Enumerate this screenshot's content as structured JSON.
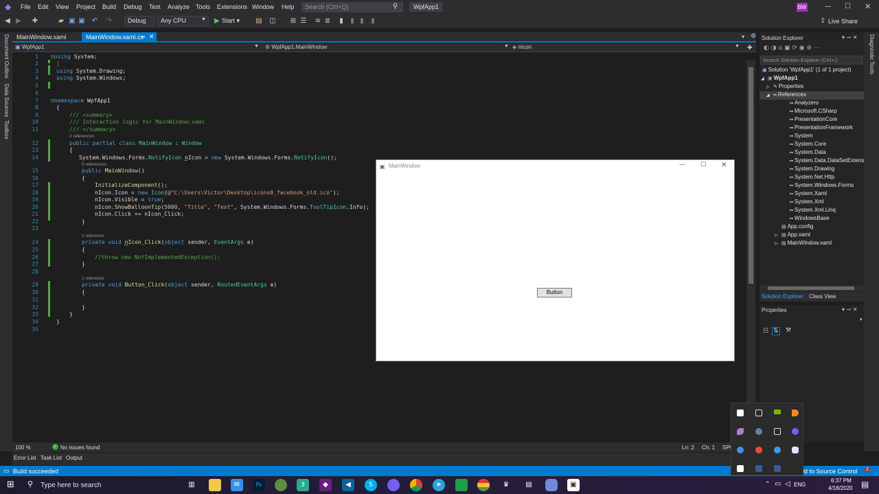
{
  "menu": [
    "File",
    "Edit",
    "View",
    "Project",
    "Build",
    "Debug",
    "Test",
    "Analyze",
    "Tools",
    "Extensions",
    "Window",
    "Help"
  ],
  "search_placeholder": "Search (Ctrl+Q)",
  "app_name": "WpfApp1",
  "user_initials": "BW",
  "live_share": "Live Share",
  "toolbar": {
    "config": "Debug",
    "platform": "Any CPU",
    "start": "Start"
  },
  "left_tool_tabs": [
    "Document Outline",
    "Data Sources",
    "Toolbox"
  ],
  "right_tool_tab": "Diagnostic Tools",
  "tabs": [
    {
      "label": "MainWindow.xaml"
    },
    {
      "label": "MainWindow.xaml.cs"
    }
  ],
  "nav": {
    "project": "WpfApp1",
    "class": "WpfApp1.MainWindow",
    "member": "nIcon"
  },
  "code": {
    "line_numbers": [
      "1",
      "2",
      "3",
      "4",
      "5",
      "6",
      "7",
      "8",
      "9",
      "10",
      "11",
      "12",
      "13",
      "14",
      "15",
      "16",
      "17",
      "18",
      "19",
      "20",
      "21",
      "22",
      "23",
      "24",
      "25",
      "26",
      "27",
      "28",
      "29",
      "30",
      "31",
      "32",
      "33",
      "34",
      "35"
    ],
    "references": {
      "r12": "2 references",
      "r15": "0 references",
      "r24": "1 reference",
      "r29": "1 reference"
    }
  },
  "editor_status": {
    "zoom": "100 %",
    "issues": "No issues found",
    "ln": "Ln: 2",
    "ch": "Ch: 1",
    "mode": "SPC"
  },
  "bottom_tabs": [
    "Error List",
    "Task List",
    "Output"
  ],
  "status": {
    "message": "Build succeeded",
    "source_control": "Add to Source Control",
    "badge": "2"
  },
  "solution_explorer": {
    "title": "Solution Explorer",
    "search": "Search Solution Explorer (Ctrl+;)",
    "solution": "Solution 'WpfApp1' (1 of 1 project)",
    "project": "WpfApp1",
    "properties": "Properties",
    "references": "References",
    "ref_items": [
      "Analyzers",
      "Microsoft.CSharp",
      "PresentationCore",
      "PresentationFramework",
      "System",
      "System.Core",
      "System.Data",
      "System.Data.DataSetExtens",
      "System.Drawing",
      "System.Net.Http",
      "System.Windows.Forms",
      "System.Xaml",
      "System.Xml",
      "System.Xml.Linq",
      "WindowsBase"
    ],
    "files": [
      "App.config",
      "App.xaml",
      "MainWindow.xaml"
    ],
    "bottom_tabs": [
      "Solution Explorer",
      "Class View"
    ]
  },
  "properties_title": "Properties",
  "main_window": {
    "title": "MainWindow",
    "button": "Button"
  },
  "taskbar": {
    "search": "Type here to search",
    "lang": "ENG",
    "time": "6:37 PM",
    "date": "4/18/2020"
  }
}
